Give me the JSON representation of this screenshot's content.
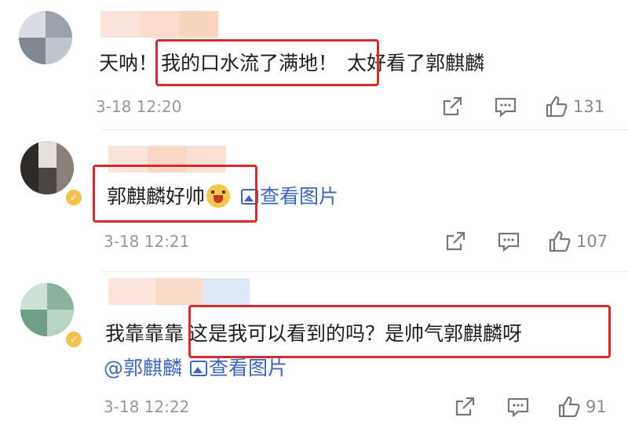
{
  "comments": [
    {
      "text_before": "天呐！",
      "text_highlight": "我的口水流了满地！",
      "text_after": "太好看了郭麒麟",
      "time": "3-18 12:20",
      "likes": "131"
    },
    {
      "text_highlight": "郭麒麟好帅",
      "link_label": "查看图片",
      "time": "3-18 12:21",
      "likes": "107"
    },
    {
      "text_before": "我靠靠靠 ",
      "text_highlight": "这是我可以看到的吗？是帅气郭麒麟呀",
      "mention": "@郭麒麟",
      "link_label": "查看图片",
      "time": "3-18 12:22",
      "likes": "91"
    }
  ],
  "colors": {
    "highlight_box": "#d32c2c",
    "link": "#3d68b7",
    "muted": "#999999"
  },
  "icons": [
    "share-icon",
    "comment-icon",
    "like-icon",
    "image-icon",
    "verified-badge-icon"
  ]
}
